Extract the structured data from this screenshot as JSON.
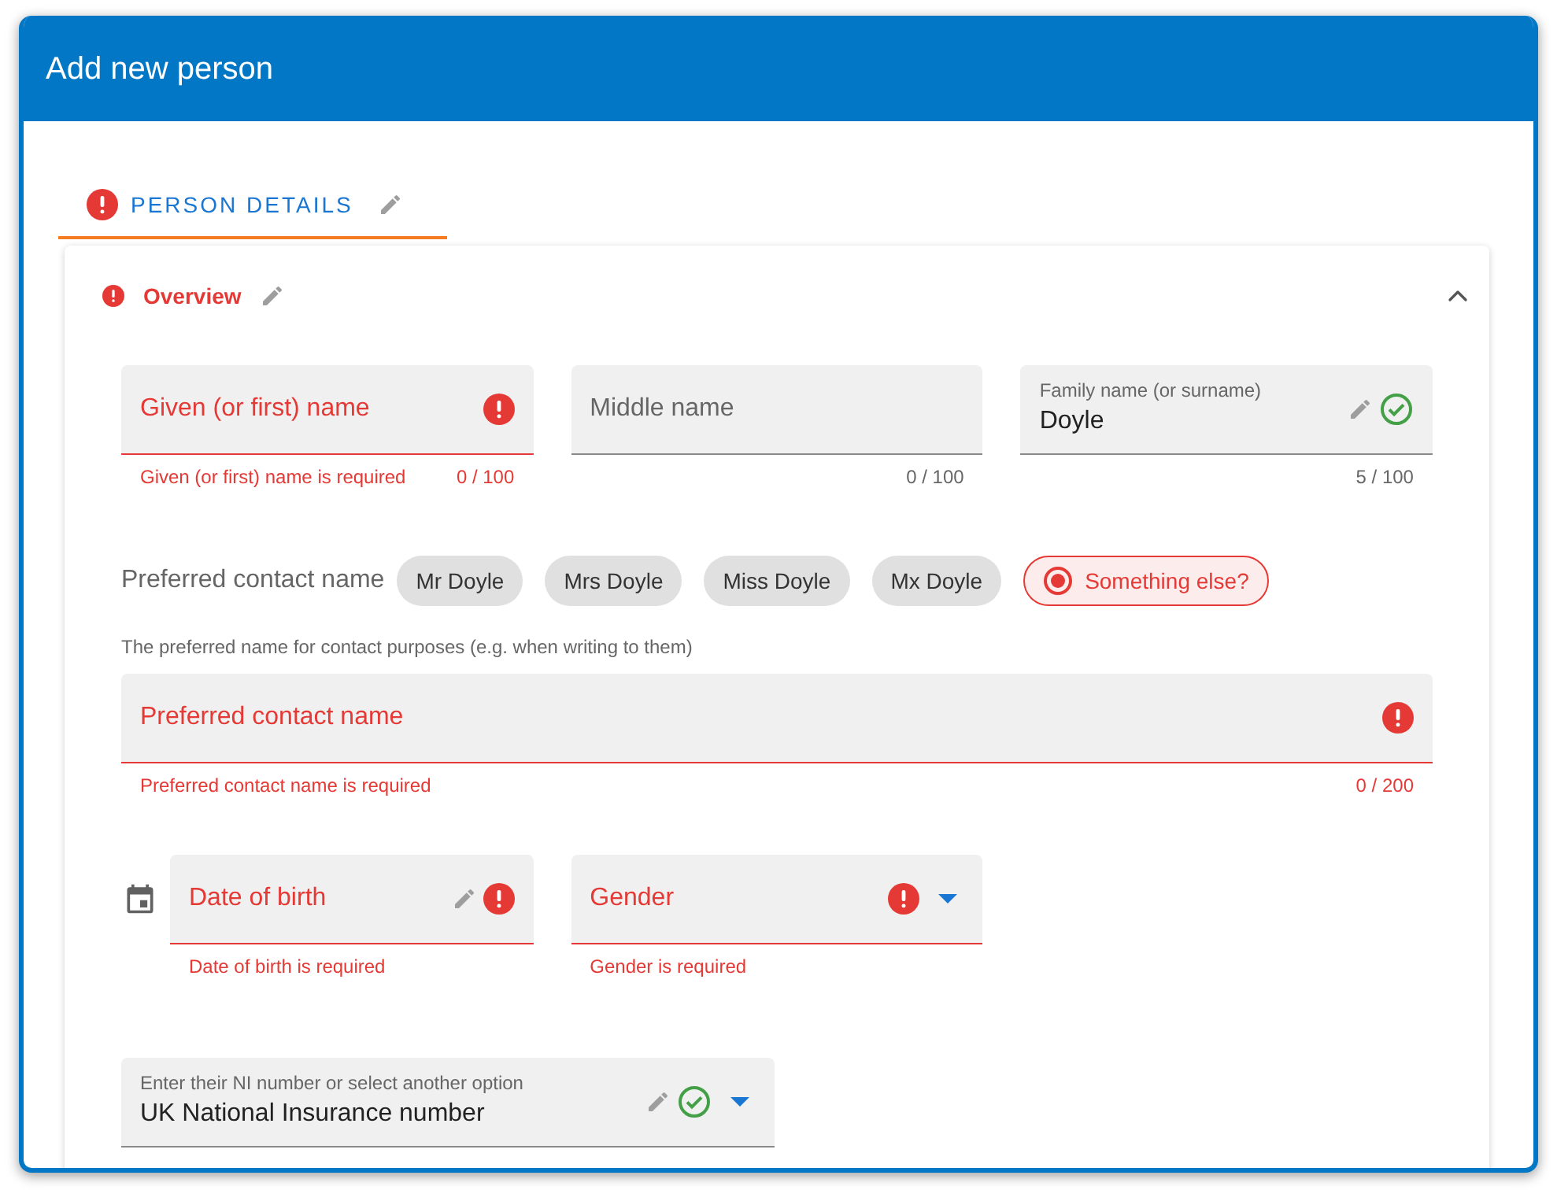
{
  "window": {
    "title": "Add new person"
  },
  "tabs": [
    {
      "label": "PERSON DETAILS",
      "selected": true,
      "invalid": true,
      "editable": true
    }
  ],
  "section": {
    "title": "Overview",
    "invalid": true,
    "editable": true,
    "expanded": true
  },
  "name_fields": [
    {
      "label": "Given (or first) name",
      "invalid": true,
      "verified": false,
      "editable": false,
      "error": "Given (or first) name is required",
      "counter": "0 / 100"
    },
    {
      "label": "Middle name",
      "invalid": false,
      "verified": false,
      "editable": false,
      "counter": "0 / 100"
    },
    {
      "label": "Family name (or surname)",
      "value": "Doyle",
      "invalid": false,
      "verified": true,
      "editable": true,
      "counter": "5 / 100"
    }
  ],
  "preferred_contact": {
    "label": "Preferred contact name",
    "chips": [
      {
        "label": "Mr Doyle",
        "selected": false
      },
      {
        "label": "Mrs Doyle",
        "selected": false
      },
      {
        "label": "Miss Doyle",
        "selected": false
      },
      {
        "label": "Mx Doyle",
        "selected": false
      },
      {
        "label": "Something else?",
        "selected": true
      }
    ],
    "hint": "The preferred name for contact purposes (e.g. when writing to them)",
    "field": {
      "label": "Preferred contact name",
      "invalid": true,
      "verified": false,
      "editable": false,
      "error": "Preferred contact name is required",
      "counter": "0 / 200"
    }
  },
  "birth_gender": [
    {
      "kind": "date",
      "label": "Date of birth",
      "invalid": true,
      "verified": false,
      "editable": true,
      "error": "Date of birth is required"
    },
    {
      "kind": "select",
      "label": "Gender",
      "invalid": true,
      "verified": false,
      "editable": false,
      "error": "Gender is required"
    }
  ],
  "ni_field": {
    "kind": "select",
    "label": "Enter their NI number or select another option",
    "value": "UK National Insurance number",
    "invalid": false,
    "verified": true,
    "editable": true
  }
}
